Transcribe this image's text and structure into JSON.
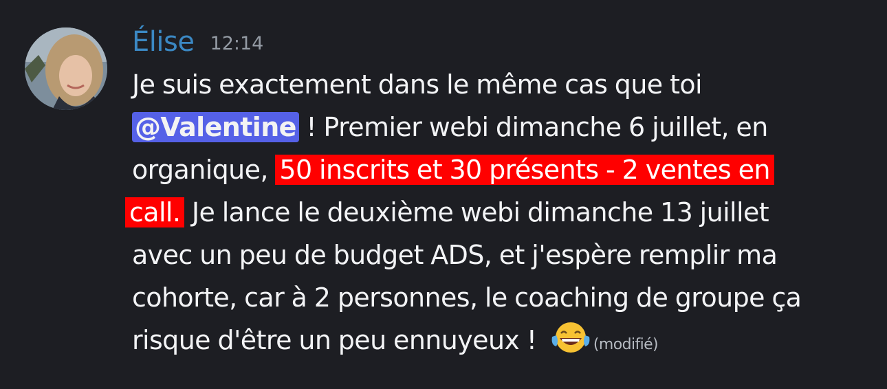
{
  "message": {
    "author": "Élise",
    "timestamp": "12:14",
    "text": {
      "line1": "Je suis exactement dans le même cas que toi",
      "mention": "@Valentine",
      "line2_rest": " ! Premier webi dimanche 6 juillet, en",
      "line3_pre": "organique, ",
      "highlight1": "50 inscrits et 30 présents - 2 ventes en",
      "highlight2": "call.",
      "line4_rest": " Je lance le deuxième webi dimanche 13 juillet",
      "line5": "avec un peu de budget ADS,  et j'espère remplir ma",
      "line6": "cohorte, car à 2 personnes, le coaching de groupe ça",
      "line7": "risque d'être un peu ennuyeux ! "
    },
    "reaction_emoji_icon": "face-with-tears-of-joy-icon",
    "edited_label": "(modifié)"
  },
  "colors": {
    "background": "#1d1e23",
    "author": "#3b88c3",
    "mention_bg": "#5865f2",
    "highlight_bg": "#ff0000"
  }
}
